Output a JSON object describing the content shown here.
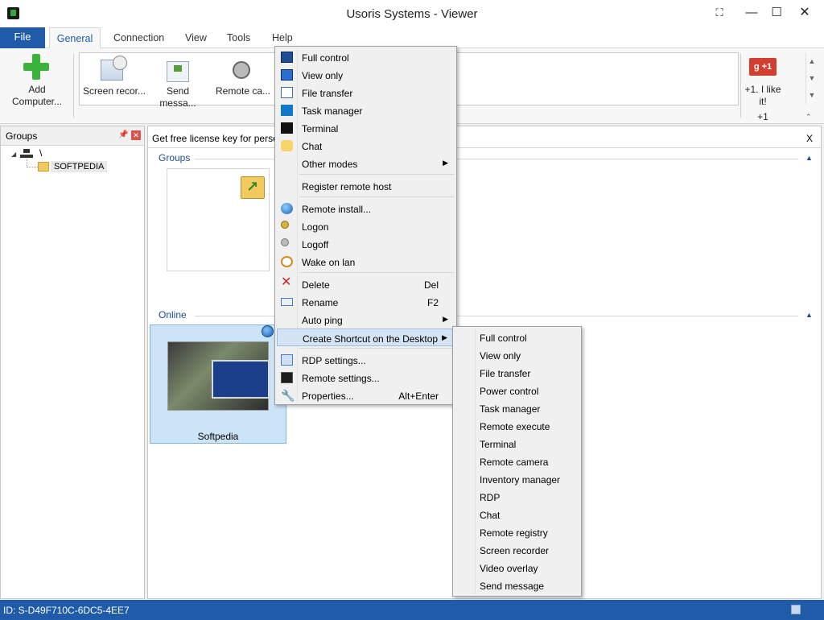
{
  "window": {
    "title": "Usoris Systems - Viewer"
  },
  "tabs": [
    "File",
    "General",
    "Connection",
    "View",
    "Tools",
    "Help"
  ],
  "ribbon": {
    "add_computer": "Add Computer...",
    "items": [
      "Screen recor...",
      "Send messa...",
      "Remote ca..."
    ],
    "gplus_badge": "g +1",
    "like_text": "+1. I like it!",
    "count": "+1"
  },
  "groups_panel": {
    "title": "Groups",
    "root": "\\",
    "item": "SOFTPEDIA"
  },
  "license_bar": {
    "text": "Get free license key for persona",
    "close": "X"
  },
  "sections": {
    "groups": "Groups",
    "online": "Online"
  },
  "host": {
    "name": "Softpedia"
  },
  "context_menu": {
    "items": [
      {
        "label": "Full control",
        "icon": "full-control-icon"
      },
      {
        "label": "View only",
        "icon": "view-only-icon"
      },
      {
        "label": "File transfer",
        "icon": "file-transfer-icon"
      },
      {
        "label": "Task manager",
        "icon": "task-manager-icon"
      },
      {
        "label": "Terminal",
        "icon": "terminal-icon"
      },
      {
        "label": "Chat",
        "icon": "chat-icon"
      },
      {
        "label": "Other modes",
        "submenu": true
      },
      {
        "label": "Register remote host"
      },
      {
        "label": "Remote install...",
        "icon": "globe-icon"
      },
      {
        "label": "Logon",
        "icon": "key-icon"
      },
      {
        "label": "Logoff",
        "icon": "key-grey-icon"
      },
      {
        "label": "Wake on lan",
        "icon": "alarm-clock-icon"
      },
      {
        "label": "Delete",
        "shortcut": "Del",
        "icon": "delete-x-icon"
      },
      {
        "label": "Rename",
        "shortcut": "F2",
        "icon": "rename-icon"
      },
      {
        "label": "Auto ping",
        "submenu": true
      },
      {
        "label": "Create Shortcut on the Desktop",
        "submenu": true
      },
      {
        "label": "RDP settings...",
        "icon": "rdp-icon"
      },
      {
        "label": "Remote settings...",
        "icon": "remote-settings-icon"
      },
      {
        "label": "Properties...",
        "shortcut": "Alt+Enter",
        "icon": "wrench-icon"
      }
    ]
  },
  "submenu": {
    "items": [
      "Full control",
      "View only",
      "File transfer",
      "Power control",
      "Task manager",
      "Remote execute",
      "Terminal",
      "Remote camera",
      "Inventory manager",
      "RDP",
      "Chat",
      "Remote registry",
      "Screen recorder",
      "Video overlay",
      "Send message"
    ]
  },
  "statusbar": {
    "id_text": "ID: S-D49F710C-6DC5-4EE7"
  },
  "colors": {
    "accent": "#1f5ba8",
    "highlight": "#d5e4f5",
    "selection": "#cce4f7"
  }
}
